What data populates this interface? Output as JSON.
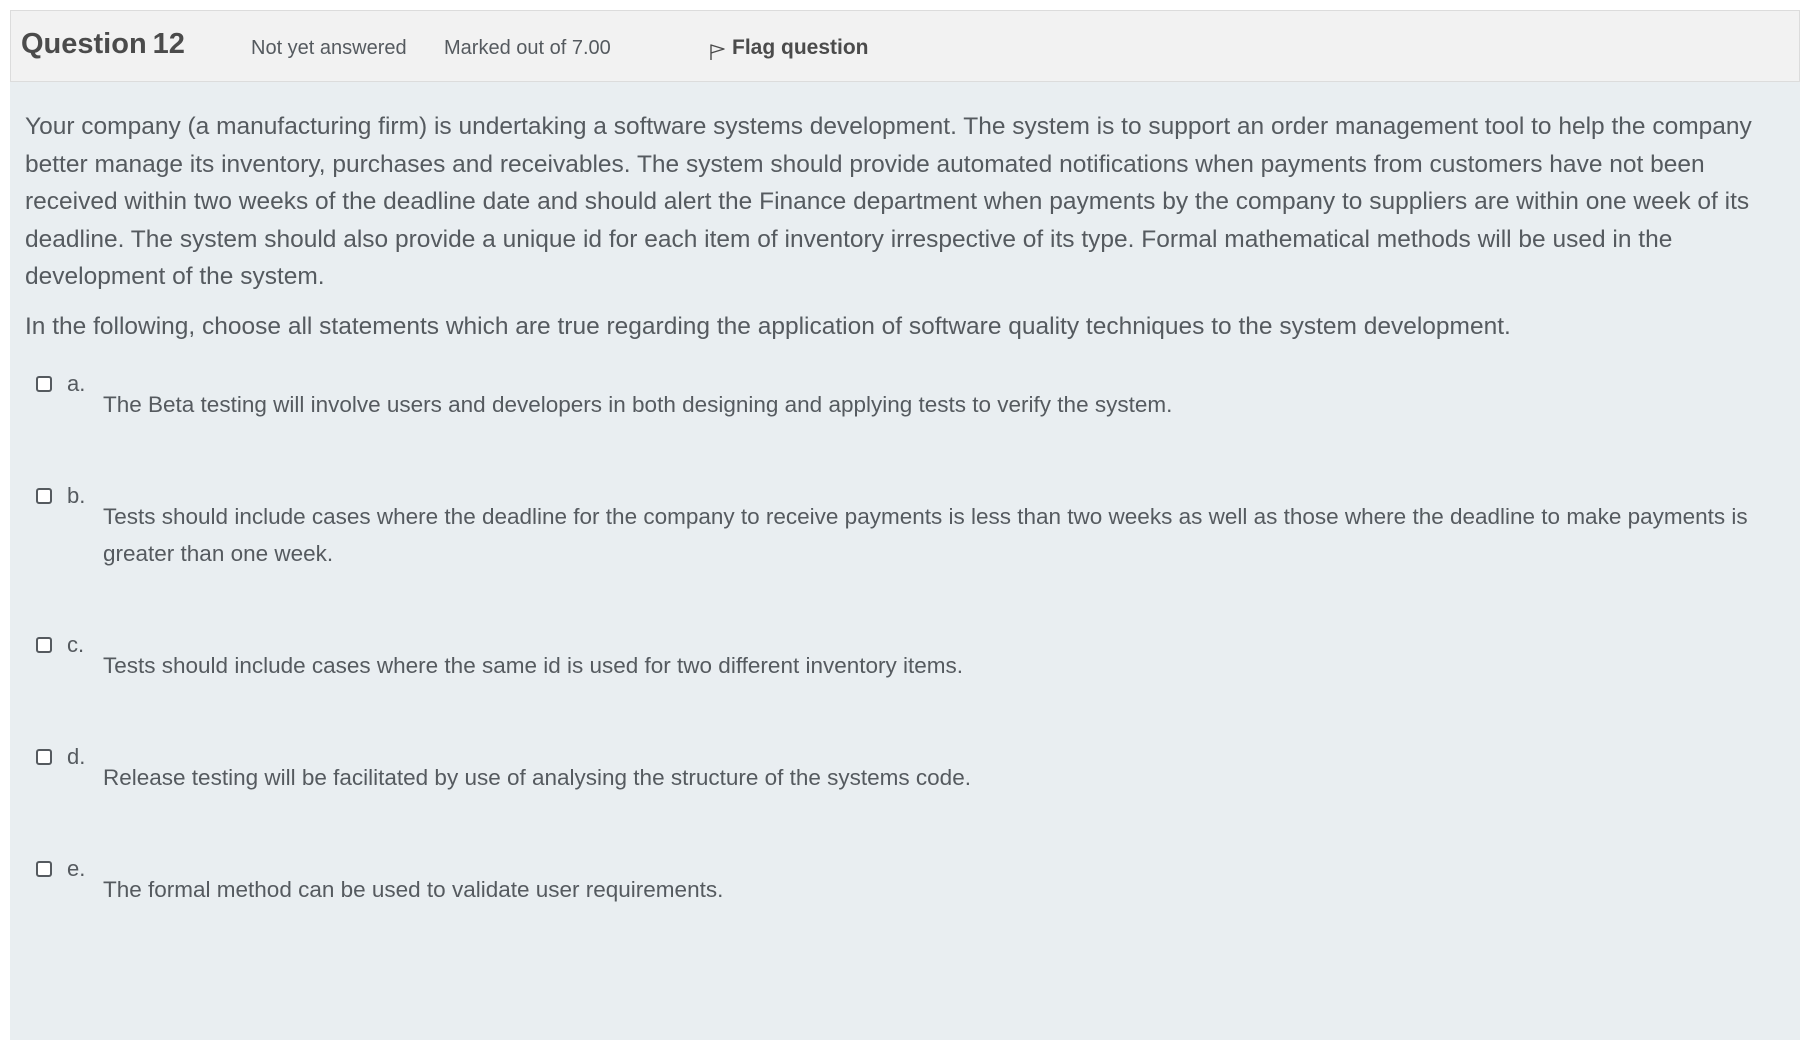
{
  "header": {
    "title_prefix": "Question",
    "question_number": "12",
    "state": "Not yet answered",
    "grade": "Marked out of 7.00",
    "flag_label": "Flag question",
    "flag_icon": "flag-outline-icon"
  },
  "question": {
    "paragraph": "Your company (a manufacturing firm) is undertaking a software systems development.  The system is to support an order management tool to help the company better manage its inventory, purchases and receivables.  The system should provide automated notifications when payments from customers have not been received within two weeks of the deadline date and should alert the Finance department when payments by the company to suppliers are within one week of its deadline.  The system should also provide a unique id for each item of inventory irrespective of its type.  Formal mathematical methods will be used in the development of the system.",
    "prompt": "In the following, choose all statements which are true regarding the application of software quality techniques to the system development."
  },
  "answers": [
    {
      "letter": "a.",
      "text": "The Beta testing will involve users and developers in both designing and applying tests to verify the system.",
      "checked": false
    },
    {
      "letter": "b.",
      "text": "Tests should include cases where the deadline for the company to receive payments is less than two weeks as well as those where the deadline to make payments is greater than one week.",
      "checked": false
    },
    {
      "letter": "c.",
      "text": "Tests should include cases where the same id is used for two different inventory items.",
      "checked": false
    },
    {
      "letter": "d.",
      "text": "Release testing will be facilitated by use of analysing the structure of the systems code.",
      "checked": false
    },
    {
      "letter": "e.",
      "text": "The formal method can be used to validate user requirements.",
      "checked": false
    }
  ],
  "colors": {
    "header_bg": "#f2f2f2",
    "body_bg": "#e9eef1",
    "text": "#555a5f"
  }
}
